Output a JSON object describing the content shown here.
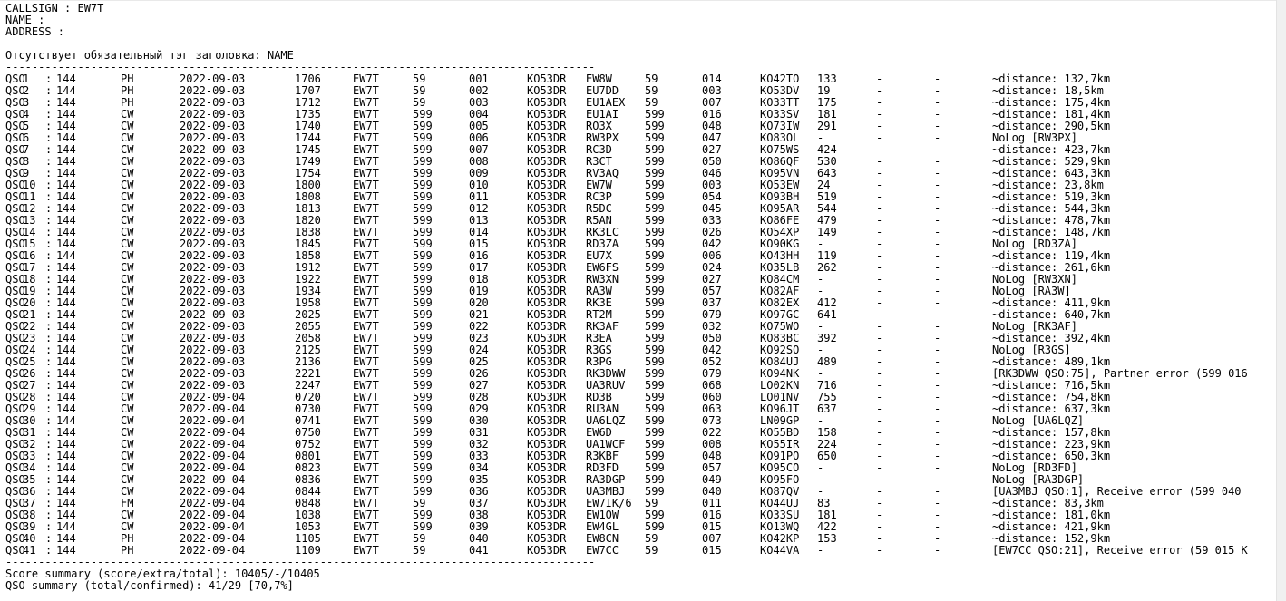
{
  "header": {
    "callsign": "CALLSIGN : EW7T",
    "name": "NAME :",
    "address": "ADDRESS :",
    "separator": "------------------------------------------------------------------------------------------",
    "warning": "Отсутствует обязательный тэг заголовка: NAME"
  },
  "qso_rows": [
    [
      "QSO",
      "1",
      "144",
      "PH",
      "2022-09-03",
      "1706",
      "EW7T",
      "59",
      "001",
      "KO53DR",
      "EW8W",
      "59",
      "014",
      "KO42TO",
      "133",
      "-",
      "-",
      "~distance: 132,7km"
    ],
    [
      "QSO",
      "2",
      "144",
      "PH",
      "2022-09-03",
      "1707",
      "EW7T",
      "59",
      "002",
      "KO53DR",
      "EU7DD",
      "59",
      "003",
      "KO53DV",
      "19",
      "-",
      "-",
      "~distance: 18,5km"
    ],
    [
      "QSO",
      "3",
      "144",
      "PH",
      "2022-09-03",
      "1712",
      "EW7T",
      "59",
      "003",
      "KO53DR",
      "EU1AEX",
      "59",
      "007",
      "KO33TT",
      "175",
      "-",
      "-",
      "~distance: 175,4km"
    ],
    [
      "QSO",
      "4",
      "144",
      "CW",
      "2022-09-03",
      "1735",
      "EW7T",
      "599",
      "004",
      "KO53DR",
      "EU1AI",
      "599",
      "016",
      "KO33SV",
      "181",
      "-",
      "-",
      "~distance: 181,4km"
    ],
    [
      "QSO",
      "5",
      "144",
      "CW",
      "2022-09-03",
      "1740",
      "EW7T",
      "599",
      "005",
      "KO53DR",
      "RO3X",
      "599",
      "048",
      "KO73IW",
      "291",
      "-",
      "-",
      "~distance: 290,5km"
    ],
    [
      "QSO",
      "6",
      "144",
      "CW",
      "2022-09-03",
      "1744",
      "EW7T",
      "599",
      "006",
      "KO53DR",
      "RW3PX",
      "599",
      "047",
      "KO83OL",
      "-",
      "-",
      "-",
      "NoLog [RW3PX]"
    ],
    [
      "QSO",
      "7",
      "144",
      "CW",
      "2022-09-03",
      "1745",
      "EW7T",
      "599",
      "007",
      "KO53DR",
      "RC3D",
      "599",
      "027",
      "KO75WS",
      "424",
      "-",
      "-",
      "~distance: 423,7km"
    ],
    [
      "QSO",
      "8",
      "144",
      "CW",
      "2022-09-03",
      "1749",
      "EW7T",
      "599",
      "008",
      "KO53DR",
      "R3CT",
      "599",
      "050",
      "KO86QF",
      "530",
      "-",
      "-",
      "~distance: 529,9km"
    ],
    [
      "QSO",
      "9",
      "144",
      "CW",
      "2022-09-03",
      "1754",
      "EW7T",
      "599",
      "009",
      "KO53DR",
      "RV3AQ",
      "599",
      "046",
      "KO95VN",
      "643",
      "-",
      "-",
      "~distance: 643,3km"
    ],
    [
      "QSO",
      "10",
      "144",
      "CW",
      "2022-09-03",
      "1800",
      "EW7T",
      "599",
      "010",
      "KO53DR",
      "EW7W",
      "599",
      "003",
      "KO53EW",
      "24",
      "-",
      "-",
      "~distance: 23,8km"
    ],
    [
      "QSO",
      "11",
      "144",
      "CW",
      "2022-09-03",
      "1808",
      "EW7T",
      "599",
      "011",
      "KO53DR",
      "RC3P",
      "599",
      "054",
      "KO93BH",
      "519",
      "-",
      "-",
      "~distance: 519,3km"
    ],
    [
      "QSO",
      "12",
      "144",
      "CW",
      "2022-09-03",
      "1813",
      "EW7T",
      "599",
      "012",
      "KO53DR",
      "R5DC",
      "599",
      "045",
      "KO95AR",
      "544",
      "-",
      "-",
      "~distance: 544,3km"
    ],
    [
      "QSO",
      "13",
      "144",
      "CW",
      "2022-09-03",
      "1820",
      "EW7T",
      "599",
      "013",
      "KO53DR",
      "R5AN",
      "599",
      "033",
      "KO86FE",
      "479",
      "-",
      "-",
      "~distance: 478,7km"
    ],
    [
      "QSO",
      "14",
      "144",
      "CW",
      "2022-09-03",
      "1838",
      "EW7T",
      "599",
      "014",
      "KO53DR",
      "RK3LC",
      "599",
      "026",
      "KO54XP",
      "149",
      "-",
      "-",
      "~distance: 148,7km"
    ],
    [
      "QSO",
      "15",
      "144",
      "CW",
      "2022-09-03",
      "1845",
      "EW7T",
      "599",
      "015",
      "KO53DR",
      "RD3ZA",
      "599",
      "042",
      "KO90KG",
      "-",
      "-",
      "-",
      "NoLog [RD3ZA]"
    ],
    [
      "QSO",
      "16",
      "144",
      "CW",
      "2022-09-03",
      "1858",
      "EW7T",
      "599",
      "016",
      "KO53DR",
      "EU7X",
      "599",
      "006",
      "KO43HH",
      "119",
      "-",
      "-",
      "~distance: 119,4km"
    ],
    [
      "QSO",
      "17",
      "144",
      "CW",
      "2022-09-03",
      "1912",
      "EW7T",
      "599",
      "017",
      "KO53DR",
      "EW6FS",
      "599",
      "024",
      "KO35LB",
      "262",
      "-",
      "-",
      "~distance: 261,6km"
    ],
    [
      "QSO",
      "18",
      "144",
      "CW",
      "2022-09-03",
      "1922",
      "EW7T",
      "599",
      "018",
      "KO53DR",
      "RW3XN",
      "599",
      "027",
      "KO84CM",
      "-",
      "-",
      "-",
      "NoLog [RW3XN]"
    ],
    [
      "QSO",
      "19",
      "144",
      "CW",
      "2022-09-03",
      "1934",
      "EW7T",
      "599",
      "019",
      "KO53DR",
      "RA3W",
      "599",
      "057",
      "KO82AF",
      "-",
      "-",
      "-",
      "NoLog [RA3W]"
    ],
    [
      "QSO",
      "20",
      "144",
      "CW",
      "2022-09-03",
      "1958",
      "EW7T",
      "599",
      "020",
      "KO53DR",
      "RK3E",
      "599",
      "037",
      "KO82EX",
      "412",
      "-",
      "-",
      "~distance: 411,9km"
    ],
    [
      "QSO",
      "21",
      "144",
      "CW",
      "2022-09-03",
      "2025",
      "EW7T",
      "599",
      "021",
      "KO53DR",
      "RT2M",
      "599",
      "079",
      "KO97GC",
      "641",
      "-",
      "-",
      "~distance: 640,7km"
    ],
    [
      "QSO",
      "22",
      "144",
      "CW",
      "2022-09-03",
      "2055",
      "EW7T",
      "599",
      "022",
      "KO53DR",
      "RK3AF",
      "599",
      "032",
      "KO75WO",
      "-",
      "-",
      "-",
      "NoLog [RK3AF]"
    ],
    [
      "QSO",
      "23",
      "144",
      "CW",
      "2022-09-03",
      "2058",
      "EW7T",
      "599",
      "023",
      "KO53DR",
      "R3EA",
      "599",
      "050",
      "KO83BC",
      "392",
      "-",
      "-",
      "~distance: 392,4km"
    ],
    [
      "QSO",
      "24",
      "144",
      "CW",
      "2022-09-03",
      "2125",
      "EW7T",
      "599",
      "024",
      "KO53DR",
      "R3GS",
      "599",
      "042",
      "KO92SO",
      "-",
      "-",
      "-",
      "NoLog [R3GS]"
    ],
    [
      "QSO",
      "25",
      "144",
      "CW",
      "2022-09-03",
      "2136",
      "EW7T",
      "599",
      "025",
      "KO53DR",
      "R3PG",
      "599",
      "052",
      "KO84UJ",
      "489",
      "-",
      "-",
      "~distance: 489,1km"
    ],
    [
      "QSO",
      "26",
      "144",
      "CW",
      "2022-09-03",
      "2221",
      "EW7T",
      "599",
      "026",
      "KO53DR",
      "RK3DWW",
      "599",
      "079",
      "KO94NK",
      "-",
      "-",
      "-",
      "[RK3DWW QSO:75], Partner error (599 016"
    ],
    [
      "QSO",
      "27",
      "144",
      "CW",
      "2022-09-03",
      "2247",
      "EW7T",
      "599",
      "027",
      "KO53DR",
      "UA3RUV",
      "599",
      "068",
      "LO02KN",
      "716",
      "-",
      "-",
      "~distance: 716,5km"
    ],
    [
      "QSO",
      "28",
      "144",
      "CW",
      "2022-09-04",
      "0720",
      "EW7T",
      "599",
      "028",
      "KO53DR",
      "RD3B",
      "599",
      "060",
      "LO01NV",
      "755",
      "-",
      "-",
      "~distance: 754,8km"
    ],
    [
      "QSO",
      "29",
      "144",
      "CW",
      "2022-09-04",
      "0730",
      "EW7T",
      "599",
      "029",
      "KO53DR",
      "RU3AN",
      "599",
      "063",
      "KO96JT",
      "637",
      "-",
      "-",
      "~distance: 637,3km"
    ],
    [
      "QSO",
      "30",
      "144",
      "CW",
      "2022-09-04",
      "0741",
      "EW7T",
      "599",
      "030",
      "KO53DR",
      "UA6LQZ",
      "599",
      "073",
      "LN09GP",
      "-",
      "-",
      "-",
      "NoLog [UA6LQZ]"
    ],
    [
      "QSO",
      "31",
      "144",
      "CW",
      "2022-09-04",
      "0750",
      "EW7T",
      "599",
      "031",
      "KO53DR",
      "EW6D",
      "599",
      "022",
      "KO55BD",
      "158",
      "-",
      "-",
      "~distance: 157,8km"
    ],
    [
      "QSO",
      "32",
      "144",
      "CW",
      "2022-09-04",
      "0752",
      "EW7T",
      "599",
      "032",
      "KO53DR",
      "UA1WCF",
      "599",
      "008",
      "KO55IR",
      "224",
      "-",
      "-",
      "~distance: 223,9km"
    ],
    [
      "QSO",
      "33",
      "144",
      "CW",
      "2022-09-04",
      "0801",
      "EW7T",
      "599",
      "033",
      "KO53DR",
      "R3KBF",
      "599",
      "048",
      "KO91PO",
      "650",
      "-",
      "-",
      "~distance: 650,3km"
    ],
    [
      "QSO",
      "34",
      "144",
      "CW",
      "2022-09-04",
      "0823",
      "EW7T",
      "599",
      "034",
      "KO53DR",
      "RD3FD",
      "599",
      "057",
      "KO95CO",
      "-",
      "-",
      "-",
      "NoLog [RD3FD]"
    ],
    [
      "QSO",
      "35",
      "144",
      "CW",
      "2022-09-04",
      "0836",
      "EW7T",
      "599",
      "035",
      "KO53DR",
      "RA3DGP",
      "599",
      "049",
      "KO95FO",
      "-",
      "-",
      "-",
      "NoLog [RA3DGP]"
    ],
    [
      "QSO",
      "36",
      "144",
      "CW",
      "2022-09-04",
      "0844",
      "EW7T",
      "599",
      "036",
      "KO53DR",
      "UA3MBJ",
      "599",
      "040",
      "KO87QV",
      "-",
      "-",
      "-",
      "[UA3MBJ QSO:1], Receive error (599 040"
    ],
    [
      "QSO",
      "37",
      "144",
      "FM",
      "2022-09-04",
      "0848",
      "EW7T",
      "59",
      "037",
      "KO53DR",
      "EW7IK/6",
      "59",
      "011",
      "KO44UJ",
      "83",
      "-",
      "-",
      "~distance: 83,3km"
    ],
    [
      "QSO",
      "38",
      "144",
      "CW",
      "2022-09-04",
      "1038",
      "EW7T",
      "599",
      "038",
      "KO53DR",
      "EW1OW",
      "599",
      "016",
      "KO33SU",
      "181",
      "-",
      "-",
      "~distance: 181,0km"
    ],
    [
      "QSO",
      "39",
      "144",
      "CW",
      "2022-09-04",
      "1053",
      "EW7T",
      "599",
      "039",
      "KO53DR",
      "EW4GL",
      "599",
      "015",
      "KO13WQ",
      "422",
      "-",
      "-",
      "~distance: 421,9km"
    ],
    [
      "QSO",
      "40",
      "144",
      "PH",
      "2022-09-04",
      "1105",
      "EW7T",
      "59",
      "040",
      "KO53DR",
      "EW8CN",
      "59",
      "007",
      "KO42KP",
      "153",
      "-",
      "-",
      "~distance: 152,9km"
    ],
    [
      "QSO",
      "41",
      "144",
      "PH",
      "2022-09-04",
      "1109",
      "EW7T",
      "59",
      "041",
      "KO53DR",
      "EW7CC",
      "59",
      "015",
      "KO44VA",
      "-",
      "-",
      "-",
      "[EW7CC QSO:21], Receive error (59 015 K"
    ]
  ],
  "footer": {
    "score_summary": "Score summary (score/extra/total): 10405/-/10405",
    "qso_summary": "QSO summary (total/confirmed): 41/29 [70,7%]"
  }
}
